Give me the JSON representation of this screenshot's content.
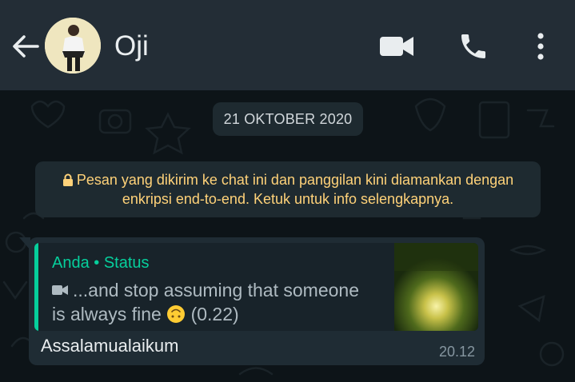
{
  "header": {
    "contact_name": "Oji",
    "back_icon": "arrow-left-icon",
    "video_icon": "video-camera-icon",
    "call_icon": "phone-icon",
    "menu_icon": "more-vertical-icon"
  },
  "chat": {
    "date_label": "21 OKTOBER 2020",
    "encryption_notice": "Pesan yang dikirim ke chat ini dan panggilan kini diamankan dengan enkripsi end-to-end. Ketuk untuk info selengkapnya.",
    "message": {
      "quote_author": "Anda • Status",
      "quote_text": "...and stop assuming that someone is always fine",
      "quote_duration": "(0.22)",
      "text": "Assalamualaikum",
      "time": "20.12"
    }
  },
  "colors": {
    "header_bg": "#232d36",
    "chat_bg": "#0d1418",
    "accent": "#06cf9c",
    "notice_text": "#ffd279",
    "bubble_bg": "#1f2c34"
  }
}
